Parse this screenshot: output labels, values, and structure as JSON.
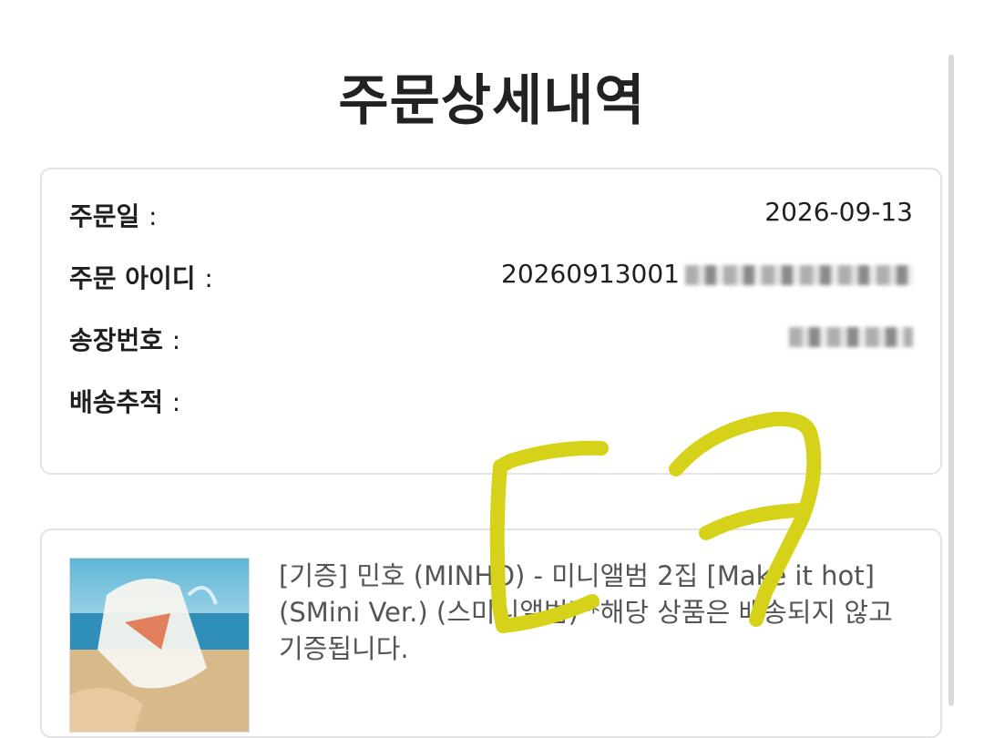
{
  "page": {
    "title": "주문상세내역"
  },
  "order_info": {
    "date_label": "주문일",
    "date_value": "2026-09-13",
    "id_label": "주문 아이디",
    "id_value": "20260913001",
    "invoice_label": "송장번호",
    "tracking_label": "배송추적",
    "colon": ":"
  },
  "product": {
    "name": "[기증] 민호 (MINHO) - 미니앨범 2집 [Make it hot] (SMini Ver.) (스미니앨범) *해당 상품은 배송되지 않고 기증됩니다."
  },
  "colors": {
    "scribble": "#d6d21a",
    "border": "#e3e3e3",
    "text": "#1f1f1f"
  }
}
